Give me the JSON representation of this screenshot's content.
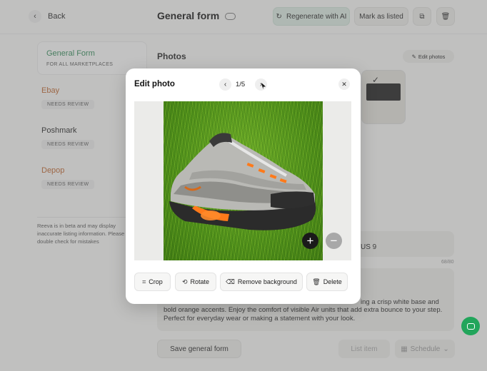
{
  "header": {
    "back_label": "Back",
    "title": "General form",
    "regenerate_label": "Regenerate with AI",
    "mark_listed_label": "Mark as listed"
  },
  "sidebar": {
    "items": [
      {
        "label": "General Form",
        "sub": "FOR ALL MARKETPLACES",
        "color": "#2e8b57"
      },
      {
        "label": "Ebay",
        "status": "NEEDS REVIEW",
        "color": "#c0632a"
      },
      {
        "label": "Poshmark",
        "status": "NEEDS REVIEW",
        "color": "#1f1f1f"
      },
      {
        "label": "Depop",
        "status": "NEEDS REVIEW",
        "color": "#c0632a"
      }
    ],
    "beta_note": "Reeva is in beta and may display inaccurate listing information. Please double check for mistakes"
  },
  "main": {
    "photos_label": "Photos",
    "edit_photos_label": "Edit photos",
    "title_value_partial": "US 9",
    "char_count": "68/80",
    "description_partial": "bold orange accents. Enjoy the comfort of visible Air units that add extra bounce to your step. Perfect for everyday wear or making a statement with your look.",
    "description_partial_right": "ing a crisp white base and"
  },
  "footer": {
    "save_label": "Save general form",
    "list_label": "List item",
    "schedule_label": "Schedule"
  },
  "modal": {
    "title": "Edit photo",
    "counter": "1/5",
    "tools": {
      "crop": "Crop",
      "rotate": "Rotate",
      "remove_bg": "Remove background",
      "delete": "Delete"
    }
  },
  "colors": {
    "accent_green": "#2e8b57",
    "regenerate_bg": "#dfeee6",
    "chat_green": "#22a55b"
  },
  "icons": [
    "chevron-left-icon",
    "cloud-icon",
    "refresh-icon",
    "copy-icon",
    "trash-icon",
    "pencil-icon",
    "chevron-right-icon",
    "close-icon",
    "plus-icon",
    "minus-icon",
    "crop-icon",
    "rotate-icon",
    "eraser-icon",
    "calendar-icon",
    "chat-icon"
  ]
}
